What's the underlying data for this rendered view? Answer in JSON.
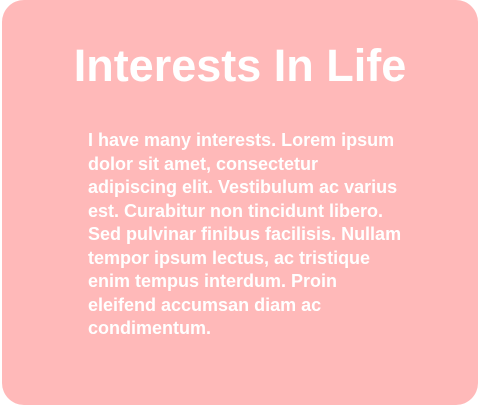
{
  "card": {
    "title": "Interests In Life",
    "body": "I have many interests. Lorem ipsum dolor sit amet, consectetur adipiscing elit. Vestibulum ac varius est. Curabitur non tincidunt libero. Sed pulvinar finibus facilisis. Nullam tempor ipsum lectus, ac tristique enim tempus interdum. Proin eleifend accumsan diam ac condimentum."
  },
  "colors": {
    "card_background": "#ffb9b9",
    "text": "#ffffff"
  }
}
